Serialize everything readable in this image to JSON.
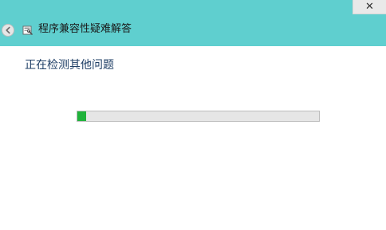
{
  "window": {
    "title": "程序兼容性疑难解答",
    "close_label": "✕"
  },
  "main": {
    "status_text": "正在检测其他问题",
    "progress": {
      "value": 0.035
    }
  },
  "colors": {
    "header_bg": "#5fcfcf",
    "progress_fill": "#1fb23a",
    "heading_text": "#1f3f66"
  },
  "icons": {
    "back": "back-arrow-icon",
    "app": "troubleshooter-app-icon",
    "close": "close-icon"
  }
}
